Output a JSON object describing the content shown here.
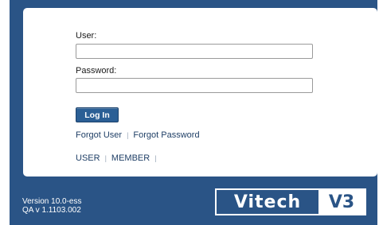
{
  "form": {
    "user_label": "User:",
    "user_value": "",
    "password_label": "Password:",
    "password_value": "",
    "login_button": "Log In"
  },
  "links": {
    "forgot_user": "Forgot User",
    "separator": "|",
    "forgot_password": "Forgot Password",
    "user": "USER",
    "member": "MEMBER"
  },
  "footer": {
    "version": "Version 10.0-ess",
    "qa_version": "QA v 1.1103.002"
  },
  "logo": {
    "word": "Vitech",
    "badge": "V3"
  },
  "colors": {
    "background": "#2a5486",
    "button": "#2b5f95",
    "link": "#1f3f66"
  }
}
